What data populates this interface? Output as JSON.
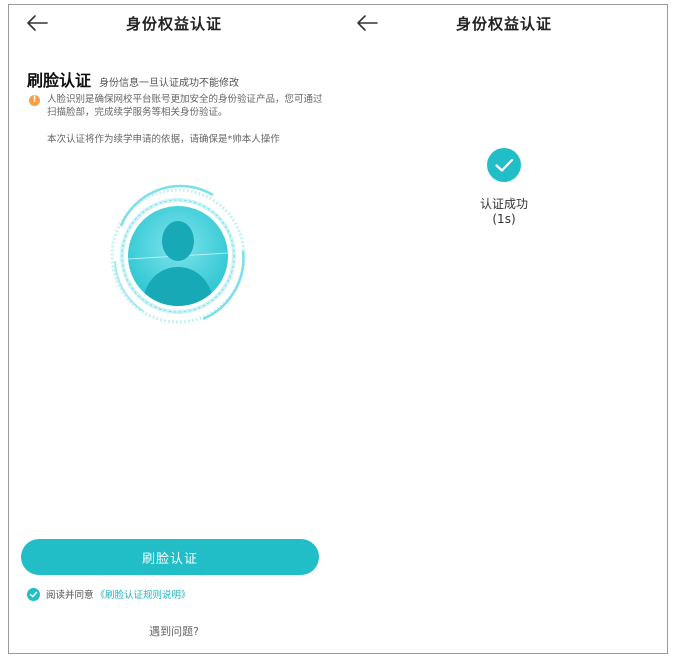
{
  "left_screen": {
    "nav": {
      "title": "身份权益认证",
      "back_icon": "arrow-left-icon"
    },
    "heading": "刷脸认证",
    "heading_note": "身份信息一旦认证成功不能修改",
    "notice_icon": "warning-icon",
    "notice_text": "人脸识别是确保网校平台账号更加安全的身份验证产品，您可通过扫描脸部，完成续学服务等相关身份验证。",
    "notice_sub": "本次认证将作为续学申请的依据，请确保是*帅本人操作",
    "face_icon": "face-scan-icon",
    "primary_button": "刷脸认证",
    "agree_text": "阅读并同意",
    "agree_link": "《刷脸认证规则说明》",
    "help_link": "遇到问题?"
  },
  "right_screen": {
    "nav": {
      "title": "身份权益认证",
      "back_icon": "arrow-left-icon"
    },
    "success_icon": "check-circle-icon",
    "success_text": "认证成功",
    "success_sub": "(1s)"
  },
  "colors": {
    "accent": "#21bec8",
    "warning": "#f5a044",
    "text_dark": "#222222",
    "text_muted": "#666666"
  }
}
